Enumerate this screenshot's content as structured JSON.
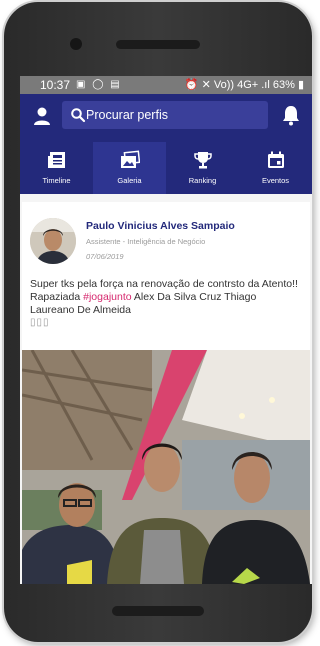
{
  "status_bar": {
    "time": "10:37",
    "left_icons": "▣ ◯ ▤",
    "right_icons": "⏰ ✕ Vo)) 4G+ .ıl 63% ▮"
  },
  "search": {
    "placeholder": "Procurar perfis"
  },
  "tabs": [
    {
      "label": "Timeline",
      "icon": "newspaper-icon"
    },
    {
      "label": "Galeria",
      "icon": "gallery-icon"
    },
    {
      "label": "Ranking",
      "icon": "trophy-icon"
    },
    {
      "label": "Eventos",
      "icon": "calendar-icon"
    }
  ],
  "post": {
    "author": "Paulo Vinicius Alves Sampaio",
    "role": "Assistente - Inteligência de Negócio",
    "date": "07/06/2019",
    "text_before": "Super tks pela força na renovação de contrsto da Atento!! Rapaziada ",
    "hashtag": "#jogajunto",
    "text_after": " Alex Da Silva Cruz Thiago Laureano De Almeida",
    "emojis": "▯▯▯"
  },
  "colors": {
    "primary": "#23297b",
    "active_tab": "#2e3591",
    "hashtag": "#d6286e",
    "status_bar": "#7a7a7a"
  }
}
